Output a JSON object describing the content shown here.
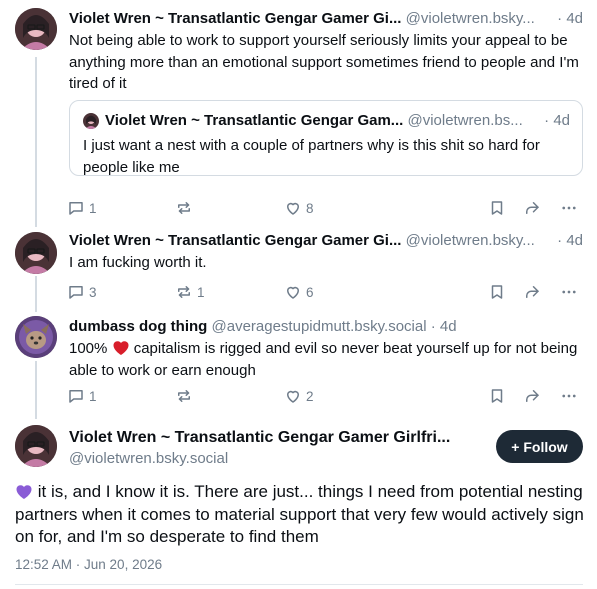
{
  "posts": [
    {
      "name": "Violet Wren ~ Transatlantic Gengar Gamer Gi...",
      "handle": "@violetwren.bsky...",
      "time": "4d",
      "text": "Not being able to work to support yourself seriously limits your appeal to be anything more than an emotional support sometimes friend to people and I'm tired of it",
      "quote": {
        "name": "Violet Wren ~ Transatlantic Gengar Gam...",
        "handle": "@violetwren.bs...",
        "time": "4d",
        "text": "I just want a nest with a couple of partners why is this shit so hard for people like me"
      },
      "replies": "1",
      "reposts": "",
      "likes": "8"
    },
    {
      "name": "Violet Wren ~ Transatlantic Gengar Gamer Gi...",
      "handle": "@violetwren.bsky...",
      "time": "4d",
      "text": "I am fucking worth it.",
      "replies": "3",
      "reposts": "1",
      "likes": "6"
    },
    {
      "name": "dumbass dog thing",
      "handle": "@averagestupidmutt.bsky.social",
      "time": "4d",
      "text_prefix": "100%",
      "text_suffix": "capitalism is rigged and evil so never beat yourself up for not being able to work or earn enough",
      "replies": "1",
      "reposts": "",
      "likes": "2"
    }
  ],
  "main_post": {
    "name": "Violet Wren ~ Transatlantic Gengar Gamer Girlfri...",
    "handle": "@violetwren.bsky.social",
    "follow_label": "+ Follow",
    "text": "it is, and I know it is. There are just... things I need from potential nesting partners when it comes to material support that very few would actively sign on for, and I'm so desperate to find them",
    "timestamp": "12:52 AM · Jun 20, 2026"
  },
  "colors": {
    "muted": "#6f7c8a",
    "thread_line": "#d4dbe2",
    "follow_bg": "#1e2a36",
    "heart_red": "#d81e2b",
    "heart_purple": "#8a5cd6"
  },
  "icons": [
    "reply-icon",
    "repost-icon",
    "like-icon",
    "bookmark-icon",
    "share-icon",
    "more-icon"
  ]
}
